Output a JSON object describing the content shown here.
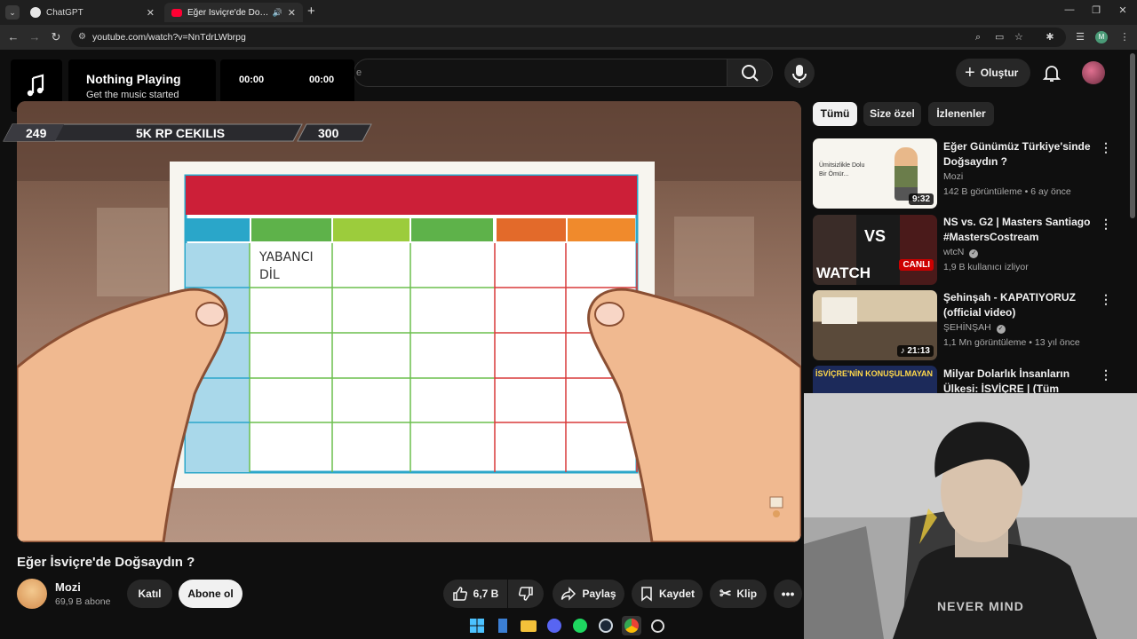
{
  "browser": {
    "tabs": [
      {
        "title": "ChatGPT",
        "active": false
      },
      {
        "title": "Eğer İsviçre'de Doğsaydın ?",
        "active": true
      }
    ],
    "url": "youtube.com/watch?v=NnTdrLWbrpg",
    "profile_initial": "M"
  },
  "music_widget": {
    "title": "Nothing Playing",
    "subtitle": "Get the music started",
    "time_current": "00:00",
    "time_total": "00:00"
  },
  "youtube_header": {
    "search_fragment": "e",
    "create_label": "Oluştur"
  },
  "video": {
    "hud_left": "249",
    "hud_center": "5K RP CEKILIS",
    "hud_right": "300",
    "grid_label": "YABANCI DİL",
    "title": "Eğer İsviçre'de Doğsaydın ?"
  },
  "channel": {
    "name": "Mozi",
    "subscribers": "69,9 B abone",
    "join_label": "Katıl",
    "subscribe_label": "Abone ol"
  },
  "actions": {
    "likes": "6,7 B",
    "share": "Paylaş",
    "save": "Kaydet",
    "clip": "Klip"
  },
  "filter_chips": [
    "Tümü",
    "Size özel",
    "İzlenenler"
  ],
  "recommendations": [
    {
      "title": "Eğer Günümüz Türkiye'sinde Doğsaydın ?",
      "channel": "Mozi",
      "meta": "142 B görüntüleme • 6 ay önce",
      "duration": "9:32",
      "thumb_caption": "Ümitsizlikle Dolu Bir Ömür..."
    },
    {
      "title": "NS vs. G2 | Masters Santiago #MastersCostream",
      "channel": "wtcN",
      "meta": "1,9 B kullanıcı izliyor",
      "duration": "CANLI",
      "thumb_caption": "WATCH"
    },
    {
      "title": "Şehinşah - KAPATIYORUZ (official video)",
      "channel": "ŞEHİNŞAH",
      "meta": "1,1 Mn görüntüleme • 13 yıl önce",
      "duration": "21:13",
      "thumb_caption": ""
    },
    {
      "title": "Milyar Dolarlık İnsanların Ülkesi: İSVİÇRE | (Tüm Gerçekleriyle!)",
      "channel": "",
      "meta": "",
      "duration": "",
      "thumb_caption": "İSVİÇRE'NİN KONUŞULMAYAN"
    }
  ],
  "webcam": {
    "shirt_text": "NEVER MIND"
  },
  "colors": {
    "accent_red": "#ff0033",
    "table_red": "#cc1f38",
    "table_blue": "#2aa6c9",
    "table_green": "#6bbf4d",
    "table_orange": "#f07a2c"
  }
}
